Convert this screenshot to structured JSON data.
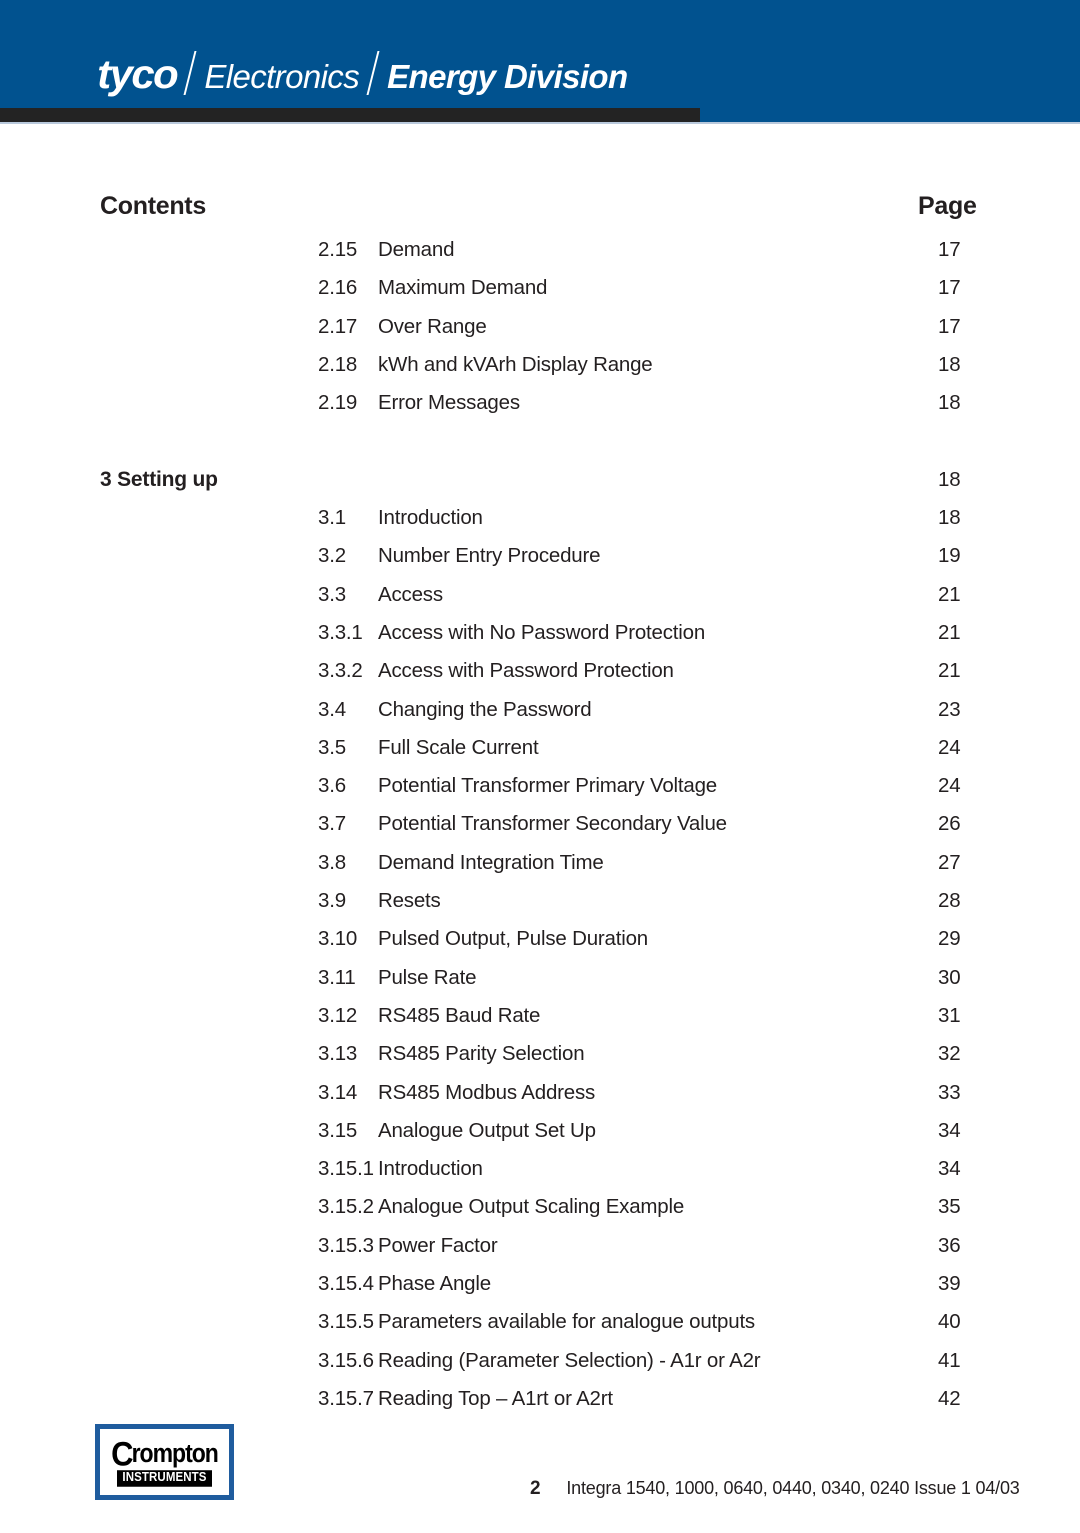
{
  "header": {
    "brand_primary": "tyco",
    "brand_secondary": "Electronics",
    "brand_tertiary": "Energy Division",
    "band_color": "#01528f",
    "dark_bar_color": "#232323"
  },
  "title": {
    "contents_label": "Contents",
    "page_label": "Page"
  },
  "toc": {
    "rows": [
      {
        "type": "entry",
        "num": "2.15",
        "label": "Demand",
        "page": "17"
      },
      {
        "type": "entry",
        "num": "2.16",
        "label": "Maximum Demand",
        "page": "17"
      },
      {
        "type": "entry",
        "num": "2.17",
        "label": "Over Range",
        "page": "17"
      },
      {
        "type": "entry",
        "num": "2.18",
        "label": "kWh and kVArh Display Range",
        "page": "18"
      },
      {
        "type": "entry",
        "num": "2.19",
        "label": "Error Messages",
        "page": "18"
      },
      {
        "type": "spacer"
      },
      {
        "type": "section",
        "title": "3 Setting up",
        "page": "18"
      },
      {
        "type": "entry",
        "num": "3.1",
        "label": "Introduction",
        "page": "18"
      },
      {
        "type": "entry",
        "num": "3.2",
        "label": "Number Entry Procedure",
        "page": "19"
      },
      {
        "type": "entry",
        "num": "3.3",
        "label": "Access",
        "page": "21"
      },
      {
        "type": "entry",
        "num": "3.3.1",
        "label": "Access with No Password Protection",
        "page": "21"
      },
      {
        "type": "entry",
        "num": "3.3.2",
        "label": "Access with Password Protection",
        "page": "21"
      },
      {
        "type": "entry",
        "num": "3.4",
        "label": "Changing the Password",
        "page": "23"
      },
      {
        "type": "entry",
        "num": "3.5",
        "label": "Full Scale Current",
        "page": "24"
      },
      {
        "type": "entry",
        "num": "3.6",
        "label": "Potential Transformer Primary Voltage",
        "page": "24"
      },
      {
        "type": "entry",
        "num": "3.7",
        "label": "Potential Transformer Secondary Value",
        "page": "26"
      },
      {
        "type": "entry",
        "num": "3.8",
        "label": "Demand Integration Time",
        "page": "27"
      },
      {
        "type": "entry",
        "num": "3.9",
        "label": "Resets",
        "page": "28"
      },
      {
        "type": "entry",
        "num": "3.10",
        "label": "Pulsed Output, Pulse Duration",
        "page": "29"
      },
      {
        "type": "entry",
        "num": "3.11",
        "label": "Pulse Rate",
        "page": "30"
      },
      {
        "type": "entry",
        "num": "3.12",
        "label": "RS485 Baud Rate",
        "page": "31"
      },
      {
        "type": "entry",
        "num": "3.13",
        "label": "RS485 Parity Selection",
        "page": "32"
      },
      {
        "type": "entry",
        "num": "3.14",
        "label": "RS485 Modbus Address",
        "page": "33"
      },
      {
        "type": "entry",
        "num": "3.15",
        "label": "Analogue Output Set Up",
        "page": "34"
      },
      {
        "type": "entry",
        "num": "3.15.1",
        "label": "Introduction",
        "page": "34"
      },
      {
        "type": "entry",
        "num": "3.15.2",
        "label": "Analogue Output Scaling Example",
        "page": "35"
      },
      {
        "type": "entry",
        "num": "3.15.3",
        "label": "Power Factor",
        "page": "36"
      },
      {
        "type": "entry",
        "num": "3.15.4",
        "label": "Phase Angle",
        "page": "39"
      },
      {
        "type": "entry",
        "num": "3.15.5",
        "label": "Parameters available for analogue outputs",
        "page": "40"
      },
      {
        "type": "entry",
        "num": "3.15.6",
        "label": "Reading (Parameter Selection) - A1r or A2r",
        "page": "41"
      },
      {
        "type": "entry",
        "num": "3.15.7",
        "label": "Reading Top – A1rt or A2rt",
        "page": "42"
      }
    ]
  },
  "footer": {
    "logo_word": "rompton",
    "logo_initial": "C",
    "logo_subtitle": "INSTRUMENTS",
    "logo_border_color": "#1f5c9e",
    "page_number": "2",
    "document_reference": "Integra 1540, 1000, 0640, 0440, 0340, 0240  Issue 1 04/03"
  }
}
